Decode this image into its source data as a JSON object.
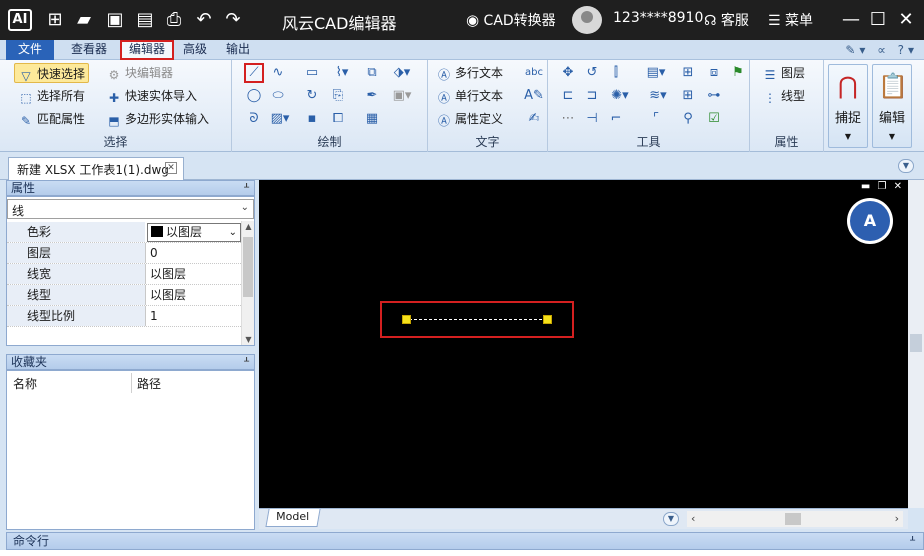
{
  "titlebar": {
    "logo": "AI",
    "title": "风云CAD编辑器",
    "converter_label": "CAD转换器",
    "user": "123****8910",
    "service_label": "客服",
    "menu_label": "菜单"
  },
  "menu": {
    "tabs": [
      {
        "label": "文件"
      },
      {
        "label": "查看器"
      },
      {
        "label": "编辑器"
      },
      {
        "label": "高级"
      },
      {
        "label": "输出"
      }
    ],
    "active_tab": "编辑器"
  },
  "ribbon": {
    "select_group": {
      "label": "选择",
      "items": [
        "快速选择",
        "块编辑器",
        "选择所有",
        "快速实体导入",
        "匹配属性",
        "多边形实体输入"
      ]
    },
    "draw_group": {
      "label": "绘制"
    },
    "text_group": {
      "label": "文字",
      "items": [
        "多行文本",
        "单行文本",
        "属性定义"
      ]
    },
    "tools_group": {
      "label": "工具"
    },
    "props_group": {
      "label": "属性",
      "items": [
        "图层",
        "线型"
      ]
    },
    "big_buttons": [
      {
        "label": "捕捉",
        "icon": "magnet-icon"
      },
      {
        "label": "编辑",
        "icon": "clipboard-icon"
      }
    ]
  },
  "document": {
    "tab_title": "新建 XLSX 工作表1(1).dwg"
  },
  "properties_panel": {
    "title": "属性",
    "entity_type": "线",
    "rows": [
      {
        "key": "色彩",
        "value": "以图层"
      },
      {
        "key": "图层",
        "value": "0"
      },
      {
        "key": "线宽",
        "value": "以图层"
      },
      {
        "key": "线型",
        "value": "以图层"
      },
      {
        "key": "线型比例",
        "value": "1"
      }
    ]
  },
  "favorites_panel": {
    "title": "收藏夹",
    "columns": [
      "名称",
      "路径"
    ]
  },
  "canvas": {
    "background": "#000000",
    "grip_color": "#f5e21b",
    "translate_label": "A"
  },
  "layout_tabs": {
    "model_label": "Model"
  },
  "command_panel": {
    "title": "命令行"
  },
  "colors": {
    "accent": "#2a63b8",
    "highlight_red": "#d42020",
    "titlebar": "#1f1f1f"
  }
}
